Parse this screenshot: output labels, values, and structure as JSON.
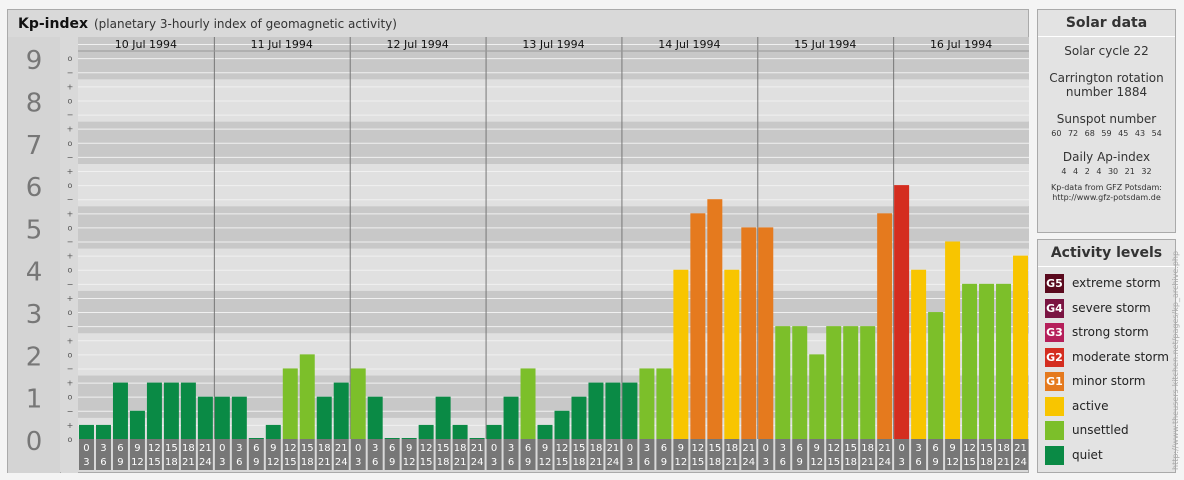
{
  "title": {
    "main": "Kp-index",
    "sub": "(planetary 3-hourly index of geomagnetic activity)"
  },
  "chart_data": {
    "type": "bar",
    "title": "Kp-index",
    "subtitle": "(planetary 3-hourly index of geomagnetic activity)",
    "ylim": [
      0,
      9
    ],
    "y_ticks": [
      "0",
      "1",
      "2",
      "3",
      "4",
      "5",
      "6",
      "7",
      "8",
      "9"
    ],
    "minor_tick_labels": [
      "o",
      "+",
      "−"
    ],
    "days": [
      "10 Jul 1994",
      "11 Jul 1994",
      "12 Jul 1994",
      "13 Jul 1994",
      "14 Jul 1994",
      "15 Jul 1994",
      "16 Jul 1994"
    ],
    "hour_labels": [
      [
        "0",
        "3"
      ],
      [
        "3",
        "6"
      ],
      [
        "6",
        "9"
      ],
      [
        "9",
        "12"
      ],
      [
        "12",
        "15"
      ],
      [
        "15",
        "18"
      ],
      [
        "18",
        "21"
      ],
      [
        "21",
        "24"
      ]
    ],
    "values": [
      0.333,
      0.333,
      1.333,
      0.667,
      1.333,
      1.333,
      1.333,
      1.0,
      1.0,
      1.0,
      0.0,
      0.333,
      1.667,
      2.0,
      1.0,
      1.333,
      1.667,
      1.0,
      0.0,
      0.0,
      0.333,
      1.0,
      0.333,
      0.0,
      0.333,
      1.0,
      1.667,
      0.333,
      0.667,
      1.0,
      1.333,
      1.333,
      1.333,
      1.667,
      1.667,
      4.0,
      5.333,
      5.667,
      4.0,
      5.0,
      5.0,
      2.667,
      2.667,
      2.0,
      2.667,
      2.667,
      2.667,
      5.333,
      6.0,
      4.0,
      3.0,
      4.667,
      3.667,
      3.667,
      3.667,
      4.333
    ],
    "grid": true
  },
  "solar": {
    "title": "Solar data",
    "cycle": "Solar cycle 22",
    "carrington1": "Carrington rotation",
    "carrington2": "number 1884",
    "sunspot_title": "Sunspot number",
    "sunspot_values": "60 72 68 59 45 43 54",
    "ap_title": "Daily Ap-index",
    "ap_values": "4 4 2 4 30 21 32",
    "source1": "Kp-data from GFZ Potsdam:",
    "source2": "http://www.gfz-potsdam.de"
  },
  "levels": {
    "title": "Activity levels",
    "items": [
      {
        "code": "G5",
        "label": "extreme storm",
        "color": "#5a0a1e"
      },
      {
        "code": "G4",
        "label": "severe storm",
        "color": "#7a1442"
      },
      {
        "code": "G3",
        "label": "strong storm",
        "color": "#b51f5a"
      },
      {
        "code": "G2",
        "label": "moderate storm",
        "color": "#d42d1f"
      },
      {
        "code": "G1",
        "label": "minor storm",
        "color": "#e57a1e"
      },
      {
        "code": "",
        "label": "active",
        "color": "#f8c500"
      },
      {
        "code": "",
        "label": "unsettled",
        "color": "#7cbf2a"
      },
      {
        "code": "",
        "label": "quiet",
        "color": "#0a8a45"
      }
    ]
  },
  "watermark": "http://www.theusers-kitchen.net/pages/kp_archive.php"
}
